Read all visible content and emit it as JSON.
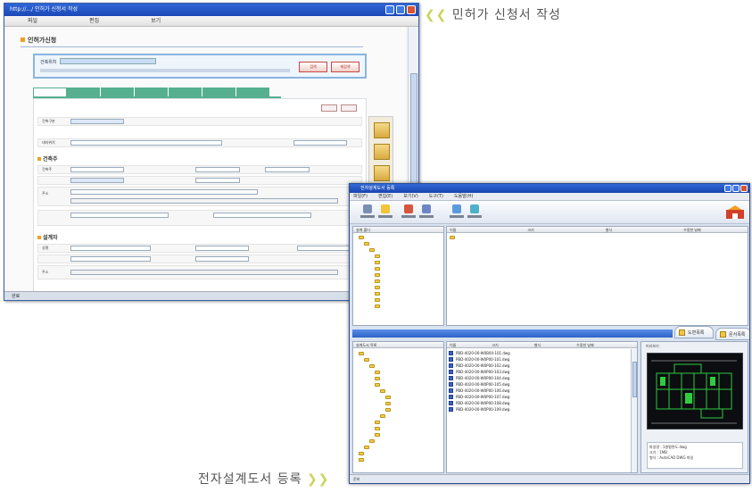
{
  "captions": {
    "top_text": "민허가 신청서 작성",
    "top_chevron": "❮❮",
    "bottom_text": "전자설계도서 등록",
    "bottom_chevron": "❯❯"
  },
  "colors": {
    "caption_chevron": "#c9d45a",
    "window_title": "#2f66d6",
    "tab_green": "#56b08f",
    "accent_orange": "#f0a020",
    "preview_green": "#2ecc40"
  },
  "win1": {
    "title": "http://.../ 인허가 신청서 작성",
    "menu": [
      "파일",
      "편집",
      "보기"
    ],
    "heading": "인허가신청",
    "search_label": "건축위치",
    "buttons": [
      "검색",
      "재검색"
    ],
    "sections": [
      "건축주",
      "설계자"
    ],
    "row_labels": [
      "건축구분",
      "대지위치",
      "건축주",
      "주소",
      "성명",
      "주소"
    ],
    "status": "완료"
  },
  "win2": {
    "title": "전자설계도서 등록",
    "menu": [
      "파일(F)",
      "편집(E)",
      "보기(V)",
      "도구(T)",
      "도움말(H)"
    ],
    "toolbar": [
      "새폴더",
      "열기",
      "등록",
      "삭제",
      "보내기",
      "받기"
    ],
    "upper_left_header": "설계 폴더",
    "upper_right_headers": [
      "이름",
      "크기",
      "형식",
      "수정한 날짜"
    ],
    "lower_left_header": "설계도서 목록",
    "lower_right_headers": [
      "이름",
      "크기",
      "형식",
      "수정한 날짜"
    ],
    "preview_label": "미리보기",
    "tabs": [
      "도면목록",
      "문서목록"
    ],
    "files": [
      "PBD-4020-00-W0B00-101.dwg",
      "PBD-4020-00-W0P00-101.dwg",
      "PBD-4020-00-W0P00-102.dwg",
      "PBD-4020-00-W0P00-103.dwg",
      "PBD-4020-00-W0P00-104.dwg",
      "PBD-4020-00-W0P00-105.dwg",
      "PBD-4020-00-W0P00-106.dwg",
      "PBD-4020-00-W0P00-107.dwg",
      "PBD-4020-00-W0P00-108.dwg",
      "PBD-4020-00-W0P00-109.dwg"
    ],
    "preview_info": [
      "파일명 : 1층평면도.dwg",
      "크기 : 1MB",
      "형식 : AutoCAD DWG 파일"
    ],
    "status": "준비"
  }
}
